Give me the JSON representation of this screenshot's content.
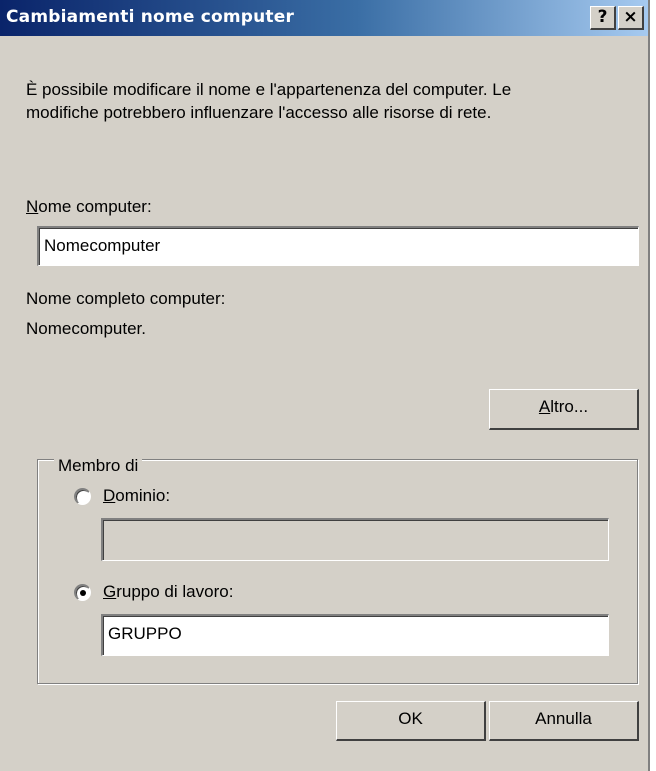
{
  "window": {
    "title": "Cambiamenti nome computer",
    "help_button": "?",
    "close_button": "×"
  },
  "description": {
    "line1": "È possibile modificare il nome e l'appartenenza del computer. Le",
    "line2": "modifiche potrebbero influenzare l'accesso alle risorse di rete."
  },
  "computer_name": {
    "label_accel": "N",
    "label_rest": "ome computer:",
    "value": "Nomecomputer"
  },
  "full_name": {
    "label": "Nome completo computer:",
    "value": "Nomecomputer."
  },
  "more_button": {
    "accel": "A",
    "rest": "ltro..."
  },
  "member_of": {
    "label": "Membro di",
    "domain": {
      "label_accel": "D",
      "label_rest": "ominio:",
      "value": "",
      "selected": false
    },
    "workgroup": {
      "label_accel": "G",
      "label_rest": "ruppo di lavoro:",
      "value": "GRUPPO",
      "selected": true
    }
  },
  "buttons": {
    "ok": "OK",
    "cancel": "Annulla"
  }
}
